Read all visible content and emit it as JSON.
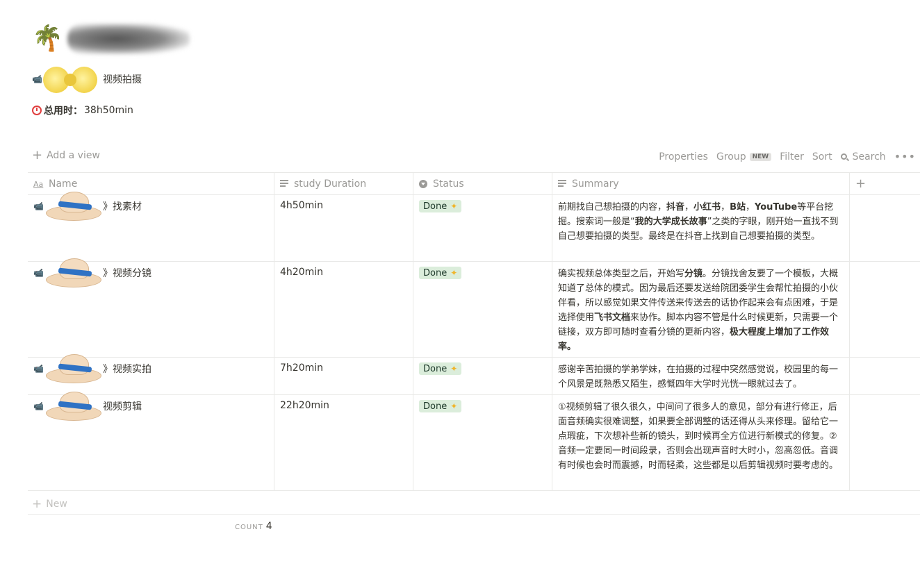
{
  "page": {
    "title_icon": "palm-tree-icon",
    "title_blurred": true,
    "subtitle": "视频拍摄",
    "total_label": "总用时：",
    "total_value": "38h50min"
  },
  "toolbar": {
    "add_view": "Add a view",
    "properties": "Properties",
    "group": "Group",
    "group_badge": "NEW",
    "filter": "Filter",
    "sort": "Sort",
    "search": "Search",
    "more": "•••"
  },
  "table": {
    "headers": {
      "name": "Name",
      "duration": "study Duration",
      "status": "Status",
      "summary": "Summary",
      "add": "+"
    },
    "rows": [
      {
        "name": "》找素材",
        "duration": "4h50min",
        "status": "Done",
        "summary_parts": [
          [
            "前期找自己想拍摄的内容，",
            false
          ],
          [
            "抖音",
            true
          ],
          [
            "，",
            false
          ],
          [
            "小红书",
            true
          ],
          [
            "，",
            false
          ],
          [
            "B站",
            true
          ],
          [
            "，",
            false
          ],
          [
            "YouTube",
            true
          ],
          [
            "等平台挖掘。搜索词一般是“",
            false
          ],
          [
            "我的大学成长故事",
            true
          ],
          [
            "”之类的字眼，刚开始一直找不到自己想要拍摄的类型。最终是在抖音上找到自己想要拍摄的类型。",
            false
          ]
        ]
      },
      {
        "name": "》视频分镜",
        "duration": "4h20min",
        "status": "Done",
        "summary_parts": [
          [
            "确实视频总体类型之后，开始写",
            false
          ],
          [
            "分镜",
            true
          ],
          [
            "。分镜找舍友要了一个模板，大概知道了总体的模式。因为最后还要发送给院团委学生会帮忙拍摄的小伙伴看，所以感觉如果文件传送来传送去的话协作起来会有点困难，于是选择使用",
            false
          ],
          [
            "飞书文档",
            true
          ],
          [
            "来协作。脚本内容不管是什么时候更新，只需要一个链接，双方即可随时查看分镜的更新内容，",
            false
          ],
          [
            "极大程度上增加了工作效率。",
            true
          ]
        ]
      },
      {
        "name": "》视频实拍",
        "duration": "7h20min",
        "status": "Done",
        "summary_parts": [
          [
            "感谢辛苦拍摄的学弟学妹，在拍摄的过程中突然感觉说，校园里的每一个风景是既熟悉又陌生，感慨四年大学时光恍一眼就过去了。",
            false
          ]
        ]
      },
      {
        "name": "视频剪辑",
        "duration": "22h20min",
        "status": "Done",
        "summary_parts": [
          [
            "①视频剪辑了很久很久，中间问了很多人的意见，部分有进行修正，后面音频确实很难调整，如果要全部调整的话还得从头来修理。留给它一点瑕疵，下次想补些新的镜头，到时候再全方位进行新模式的修复。②音频一定要同一时间段录，否则会出现声音时大时小，忽高忽低。音调有时候也会时而震撼，时而轻柔，这些都是以后剪辑视频时要考虑的。",
            false
          ]
        ]
      }
    ],
    "new_label": "New",
    "count_label": "COUNT",
    "count_value": "4"
  }
}
